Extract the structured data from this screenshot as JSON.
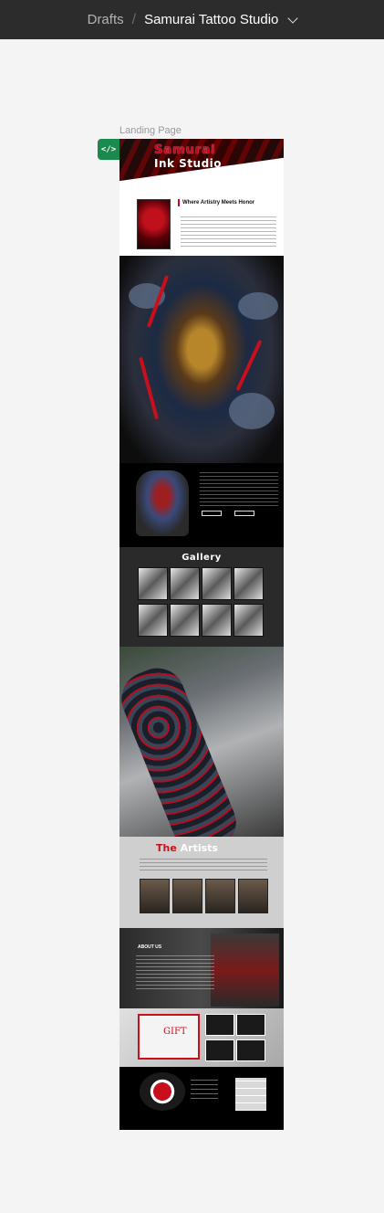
{
  "topbar": {
    "crumb": "Drafts",
    "separator": "/",
    "project": "Samurai Tattoo Studio"
  },
  "frame": {
    "label": "Landing Page",
    "dev_badge": "</>"
  },
  "landing": {
    "hero_line1": "Samurai",
    "hero_line2": "Ink Studio",
    "intro_title": "Where Artistry Meets Honor",
    "gallery_title": "Gallery",
    "artists_title_red": "The",
    "artists_title_white": " Artists",
    "about_title": "ABOUT US",
    "gift_text": "GIFT"
  },
  "colors": {
    "topbar": "#2c2c2c",
    "canvas": "#f4f4f4",
    "accent": "#d0021b",
    "dev_badge": "#1b8a4e"
  }
}
